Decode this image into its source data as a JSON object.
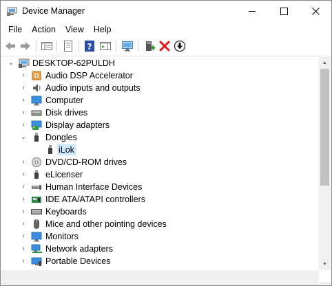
{
  "window": {
    "title": "Device Manager"
  },
  "menu": [
    {
      "id": "file",
      "label": "File"
    },
    {
      "id": "action",
      "label": "Action"
    },
    {
      "id": "view",
      "label": "View"
    },
    {
      "id": "help",
      "label": "Help"
    }
  ],
  "toolbar": [
    {
      "name": "back-button-icon"
    },
    {
      "name": "forward-button-icon"
    },
    {
      "name": "show-hide-console-tree-icon"
    },
    {
      "name": "properties-icon"
    },
    {
      "name": "help-icon"
    },
    {
      "name": "action-pane-icon"
    },
    {
      "name": "scan-hardware-changes-icon"
    },
    {
      "name": "update-driver-icon"
    },
    {
      "name": "uninstall-device-icon"
    },
    {
      "name": "disable-device-icon"
    }
  ],
  "tree": {
    "root": {
      "label": "DESKTOP-62PULDH",
      "expanded": true,
      "icon": "computer-icon"
    },
    "items": [
      {
        "label": "Audio DSP Accelerator",
        "icon": "audio-dsp-icon",
        "expanded": false
      },
      {
        "label": "Audio inputs and outputs",
        "icon": "speaker-icon",
        "expanded": false
      },
      {
        "label": "Computer",
        "icon": "monitor-icon",
        "expanded": false
      },
      {
        "label": "Disk drives",
        "icon": "disk-drive-icon",
        "expanded": false
      },
      {
        "label": "Display adapters",
        "icon": "display-adapter-icon",
        "expanded": false
      },
      {
        "label": "Dongles",
        "icon": "dongle-icon",
        "expanded": true,
        "children": [
          {
            "label": "iLok",
            "icon": "dongle-icon",
            "selected": true
          }
        ]
      },
      {
        "label": "DVD/CD-ROM drives",
        "icon": "dvd-icon",
        "expanded": false
      },
      {
        "label": "eLicenser",
        "icon": "dongle-icon",
        "expanded": false
      },
      {
        "label": "Human Interface Devices",
        "icon": "hid-icon",
        "expanded": false
      },
      {
        "label": "IDE ATA/ATAPI controllers",
        "icon": "ide-controller-icon",
        "expanded": false
      },
      {
        "label": "Keyboards",
        "icon": "keyboard-icon",
        "expanded": false
      },
      {
        "label": "Mice and other pointing devices",
        "icon": "mouse-icon",
        "expanded": false
      },
      {
        "label": "Monitors",
        "icon": "monitor-icon",
        "expanded": false
      },
      {
        "label": "Network adapters",
        "icon": "network-adapter-icon",
        "expanded": false
      },
      {
        "label": "Portable Devices",
        "icon": "portable-device-icon",
        "expanded": false
      }
    ]
  },
  "colors": {
    "selection": "#cce8ff",
    "scroll_thumb": "#c1c1c1"
  }
}
